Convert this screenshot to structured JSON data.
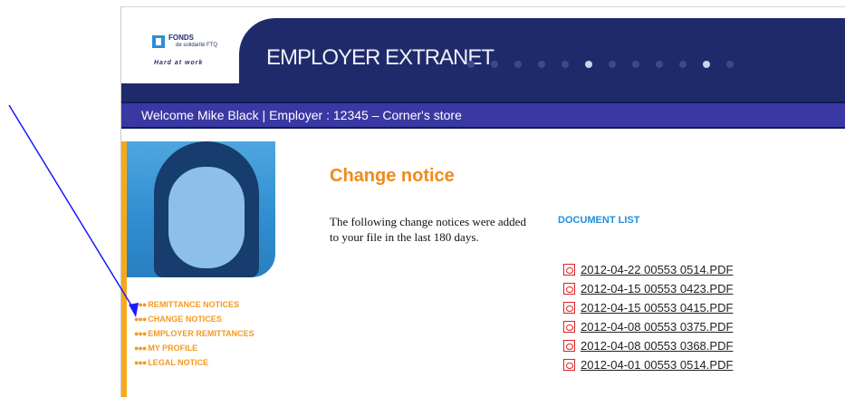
{
  "logo": {
    "name": "FONDS",
    "sub": "de solidarité FTQ",
    "tagline": "Hard at work"
  },
  "banner": {
    "title": "EMPLOYER EXTRANET"
  },
  "welcome_bar": {
    "text": "Welcome Mike Black |  Employer : 12345 – Corner's store"
  },
  "side_menu": {
    "items": [
      {
        "label": "REMITTANCE NOTICES"
      },
      {
        "label": "CHANGE NOTICES"
      },
      {
        "label": "EMPLOYER REMITTANCES"
      },
      {
        "label": "MY PROFILE"
      },
      {
        "label": "LEGAL NOTICE"
      }
    ]
  },
  "main": {
    "title": "Change notice",
    "intro": "The following change notices were added to your file in the last 180 days."
  },
  "document_list": {
    "heading": "DOCUMENT LIST",
    "items": [
      "2012-04-22 00553 0514.PDF",
      "2012-04-15 00553 0423.PDF",
      "2012-04-15 00553 0415.PDF",
      "2012-04-08 00553 0375.PDF",
      "2012-04-08 00553 0368.PDF",
      "2012-04-01 00553 0514.PDF"
    ]
  },
  "colors": {
    "navy": "#1f2a6a",
    "welcome_bar": "#3a38a2",
    "orange": "#f08a1a",
    "link_blue": "#1f8fd8",
    "arrow": "#1010ff"
  },
  "icons": [
    "fonds-logo-icon",
    "pdf-icon",
    "blue-arrow-annotation"
  ]
}
